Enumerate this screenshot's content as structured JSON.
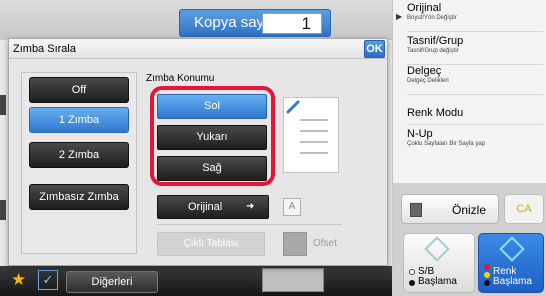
{
  "header": {
    "copies_label": "Kopya sayısı",
    "copies_value": "1"
  },
  "right_panel": [
    {
      "title": "Orijinal",
      "subtitle": "Boyut/Yön Değiştir"
    },
    {
      "title": "Tasnif/Grup",
      "subtitle": "Tasnif/Grup değiştir"
    },
    {
      "title": "Delgeç",
      "subtitle": "Delgeç Delikleri"
    },
    {
      "title": "Renk Modu",
      "subtitle": ""
    },
    {
      "title": "N-Up",
      "subtitle": "Çoklu Sayfaları Bir Sayfa yap"
    }
  ],
  "actions": {
    "preview": "Önizle",
    "ca": "CA",
    "start_bw": [
      "S/B",
      "Başlama"
    ],
    "start_color": [
      "Renk",
      "Başlama"
    ]
  },
  "bottom": {
    "others": "Diğerleri"
  },
  "dialog": {
    "title": "Zımba Sırala",
    "ok": "OK",
    "modes": [
      "Off",
      "1 Zımba",
      "2 Zımba",
      "Zımbasız Zımba"
    ],
    "selected_mode": "1 Zımba",
    "position_heading": "Zımba Konumu",
    "positions": [
      "Sol",
      "Yukarı",
      "Sağ"
    ],
    "selected_position": "Sol",
    "original_button": "Orijinal",
    "a_label": "A",
    "tray_button": "Çıktı Tablası",
    "offset_label": "Ofset"
  },
  "colors": {
    "accent_blue": "#2f78cf",
    "highlight_red": "#e3163a",
    "ca_yellow": "#d9a800"
  }
}
